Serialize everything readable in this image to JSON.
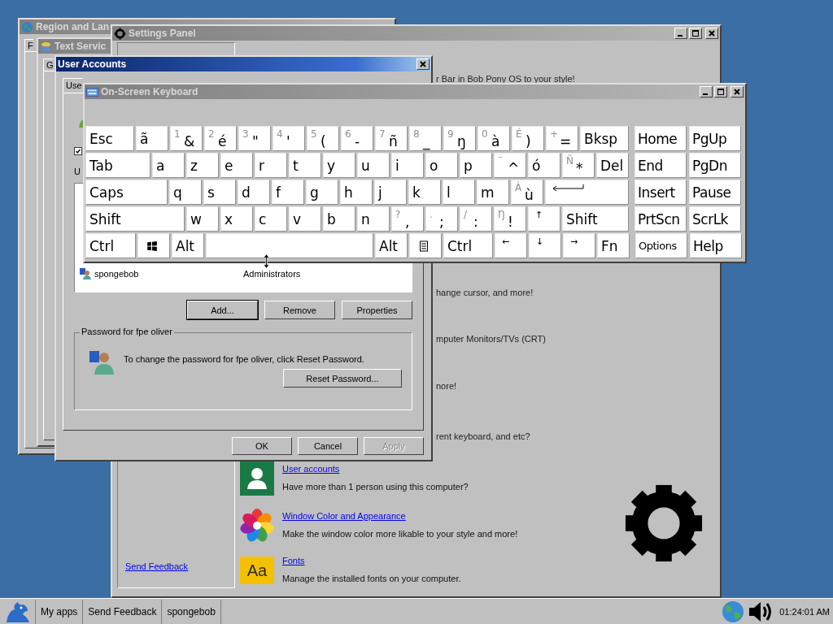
{
  "region_window": {
    "title": "Region and Lan",
    "tab": "F"
  },
  "text_services_window": {
    "title": "Text Servic",
    "tab": "G"
  },
  "settings_panel": {
    "title": "Settings Panel",
    "sidebar_link": "Send Feedback",
    "covered_descriptions": [
      "r Bar in Bob Pony OS to your style!",
      "hange cursor, and more!",
      "mputer Monitors/TVs (CRT)",
      "nore!",
      "rent keyboard, and etc?"
    ],
    "items": [
      {
        "kind": "user",
        "link": "User accounts",
        "description": "Have more than 1 person using this computer?"
      },
      {
        "kind": "palette",
        "link": "Window Color and Appearance",
        "description": "Make the window color more likable to your style and more!"
      },
      {
        "kind": "fonts",
        "icon_text": "Aa",
        "link": "Fonts",
        "description": "Manage the installed fonts on your computer."
      }
    ]
  },
  "user_accounts": {
    "title": "User Accounts",
    "tab": "Use",
    "checkbox": {
      "checked": true
    },
    "label": "U",
    "users": [
      {
        "name": "spongebob",
        "group": "Administrators"
      }
    ],
    "list_buttons": [
      {
        "label": "Add...",
        "focused": true
      },
      {
        "label": "Remove",
        "focused": false
      },
      {
        "label": "Properties",
        "focused": false
      }
    ],
    "password_group": {
      "legend": "Password for fpe oliver",
      "text": "To change the password for fpe oliver, click Reset Password.",
      "button": "Reset Password..."
    },
    "dialog_buttons": [
      {
        "label": "OK",
        "disabled": false
      },
      {
        "label": "Cancel",
        "disabled": false
      },
      {
        "label": "Apply",
        "disabled": true
      }
    ]
  },
  "keyboard": {
    "title": "On-Screen Keyboard",
    "rows": [
      {
        "keys": [
          {
            "kind": "text",
            "label": "Esc"
          },
          {
            "kind": "text",
            "label": "ã"
          },
          {
            "kind": "dual",
            "shift": "1",
            "label": "&"
          },
          {
            "kind": "dual",
            "shift": "2",
            "label": "é"
          },
          {
            "kind": "dual",
            "shift": "3",
            "label": "\""
          },
          {
            "kind": "dual",
            "shift": "4",
            "label": "'"
          },
          {
            "kind": "dual",
            "shift": "5",
            "label": "("
          },
          {
            "kind": "dual",
            "shift": "6",
            "label": "-"
          },
          {
            "kind": "dual",
            "shift": "7",
            "label": "ñ"
          },
          {
            "kind": "dual",
            "shift": "8",
            "label": "_"
          },
          {
            "kind": "dual",
            "shift": "9",
            "label": "ŋ"
          },
          {
            "kind": "dual",
            "shift": "0",
            "label": "à"
          },
          {
            "kind": "dual",
            "shift": "É",
            "label": ")"
          },
          {
            "kind": "dual",
            "shift": "+",
            "label": "="
          },
          {
            "kind": "text",
            "label": "Bksp"
          }
        ],
        "nav": [
          {
            "kind": "text",
            "label": "Home"
          },
          {
            "kind": "text",
            "label": "PgUp"
          }
        ]
      },
      {
        "keys": [
          {
            "kind": "text",
            "label": "Tab"
          },
          {
            "kind": "text",
            "label": "a"
          },
          {
            "kind": "text",
            "label": "z"
          },
          {
            "kind": "text",
            "label": "e"
          },
          {
            "kind": "text",
            "label": "r"
          },
          {
            "kind": "text",
            "label": "t"
          },
          {
            "kind": "text",
            "label": "y"
          },
          {
            "kind": "text",
            "label": "u"
          },
          {
            "kind": "text",
            "label": "i"
          },
          {
            "kind": "text",
            "label": "o"
          },
          {
            "kind": "text",
            "label": "p"
          },
          {
            "kind": "dual",
            "shift": "¨",
            "label": "^"
          },
          {
            "kind": "text",
            "label": "ó"
          },
          {
            "kind": "dual",
            "shift": "Ñ",
            "label": "*"
          },
          {
            "kind": "text",
            "label": "Del"
          }
        ],
        "nav": [
          {
            "kind": "text",
            "label": "End"
          },
          {
            "kind": "text",
            "label": "PgDn"
          }
        ]
      },
      {
        "keys": [
          {
            "kind": "text",
            "label": "Caps"
          },
          {
            "kind": "text",
            "label": "q"
          },
          {
            "kind": "text",
            "label": "s"
          },
          {
            "kind": "text",
            "label": "d"
          },
          {
            "kind": "text",
            "label": "f"
          },
          {
            "kind": "text",
            "label": "g"
          },
          {
            "kind": "text",
            "label": "h"
          },
          {
            "kind": "text",
            "label": "j"
          },
          {
            "kind": "text",
            "label": "k"
          },
          {
            "kind": "text",
            "label": "l"
          },
          {
            "kind": "text",
            "label": "m"
          },
          {
            "kind": "dual",
            "shift": "À",
            "label": "ù"
          },
          {
            "kind": "enter"
          }
        ],
        "nav": [
          {
            "kind": "text",
            "label": "Insert"
          },
          {
            "kind": "text",
            "label": "Pause"
          }
        ]
      },
      {
        "keys": [
          {
            "kind": "text",
            "label": "Shift"
          },
          {
            "kind": "text",
            "label": "w"
          },
          {
            "kind": "text",
            "label": "x"
          },
          {
            "kind": "text",
            "label": "c"
          },
          {
            "kind": "text",
            "label": "v"
          },
          {
            "kind": "text",
            "label": "b"
          },
          {
            "kind": "text",
            "label": "n"
          },
          {
            "kind": "dual",
            "shift": "?",
            "label": ","
          },
          {
            "kind": "dual",
            "shift": ".",
            "label": ";"
          },
          {
            "kind": "dual",
            "shift": "/",
            "label": ":"
          },
          {
            "kind": "dual",
            "shift": "Ŋ",
            "label": "!"
          },
          {
            "kind": "arrow",
            "label": "↑"
          },
          {
            "kind": "text",
            "label": "Shift"
          }
        ],
        "nav": [
          {
            "kind": "text",
            "label": "PrtScn"
          },
          {
            "kind": "text",
            "label": "ScrLk"
          }
        ]
      },
      {
        "keys": [
          {
            "kind": "text",
            "label": "Ctrl"
          },
          {
            "kind": "windows"
          },
          {
            "kind": "text",
            "label": "Alt"
          },
          {
            "kind": "space"
          },
          {
            "kind": "text",
            "label": "Alt"
          },
          {
            "kind": "menu"
          },
          {
            "kind": "text",
            "label": "Ctrl"
          },
          {
            "kind": "arrow",
            "label": "←"
          },
          {
            "kind": "arrow",
            "label": "↓"
          },
          {
            "kind": "arrow",
            "label": "→"
          },
          {
            "kind": "text",
            "label": "Fn"
          }
        ],
        "nav": [
          {
            "kind": "small",
            "label": "Options"
          },
          {
            "kind": "text",
            "label": "Help"
          }
        ]
      }
    ]
  },
  "taskbar": {
    "items": [
      "My apps",
      "Send Feedback",
      "spongebob"
    ],
    "clock": "01:24:01 AM"
  }
}
